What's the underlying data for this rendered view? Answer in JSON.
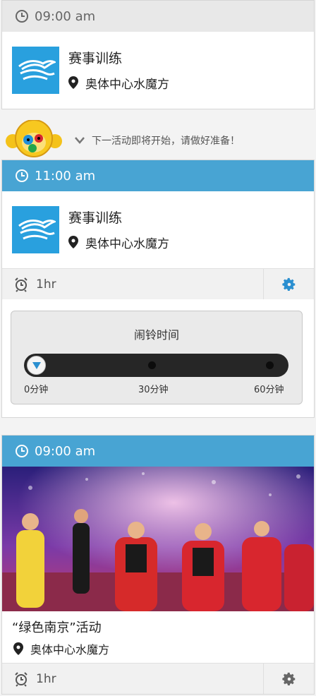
{
  "card1": {
    "time": "09:00 am",
    "title": "赛事训练",
    "location": "奥体中心水魔方"
  },
  "notice": {
    "text": "下一活动即将开始，请做好准备！"
  },
  "card2": {
    "time": "11:00 am",
    "title": "赛事训练",
    "location": "奥体中心水魔方",
    "duration": "1hr",
    "alarm": {
      "title": "闹铃时间",
      "labels": [
        "0分钟",
        "30分钟",
        "60分钟"
      ],
      "value_minutes": 0
    }
  },
  "card3": {
    "time": "09:00 am",
    "title": "“绿色南京”活动",
    "location": "奥体中心水魔方",
    "duration": "1hr"
  },
  "colors": {
    "accent_blue": "#48a4d3",
    "thumb_blue": "#29a0de",
    "gear_blue": "#2a8fd0",
    "gray_bar": "#e8e8e8"
  },
  "icons": [
    "clock-icon",
    "location-pin-icon",
    "alarm-clock-icon",
    "gear-icon",
    "chevron-down-icon",
    "swimmer-logo-icon",
    "mascot-icon"
  ]
}
